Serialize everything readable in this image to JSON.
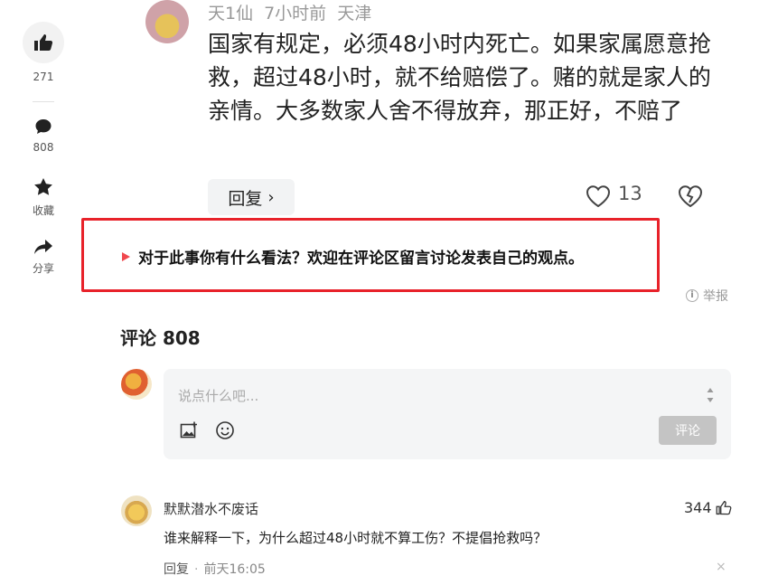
{
  "sidebar": {
    "like_count": "271",
    "comment_count": "808",
    "favorite_label": "收藏",
    "share_label": "分享",
    "icons": [
      "thumbs-up-icon",
      "comment-bubble-icon",
      "star-icon",
      "share-arrow-icon"
    ]
  },
  "top_comment": {
    "username": "天1仙",
    "time": "7小时前",
    "location": "天津",
    "text": "国家有规定，必须48小时内死亡。如果家属愿意抢救，超过48小时，就不给赔偿了。赌的就是家人的亲情。大多数家人舍不得放弃，那正好，不赔了",
    "reply_label": "回复",
    "reply_chevron": "›",
    "like_count": "13"
  },
  "prompt": {
    "text": "对于此事你有什么看法？欢迎在评论区留言讨论发表自己的观点。"
  },
  "report_label": "举报",
  "report_icon_glyph": "i",
  "comments_title": "评论 808",
  "input": {
    "placeholder": "说点什么吧...",
    "submit_label": "评论"
  },
  "comments": [
    {
      "username": "默默潜水不废话",
      "likes": "344",
      "text": "谁来解释一下，为什么超过48小时就不算工伤？不提倡抢救吗？",
      "reply_label": "回复",
      "separator": "·",
      "time": "前天16:05",
      "close_glyph": "×"
    }
  ],
  "colors": {
    "highlight_border": "#e8222a",
    "triangle": "#f0484e",
    "submit_bg": "#c4c4c4"
  }
}
